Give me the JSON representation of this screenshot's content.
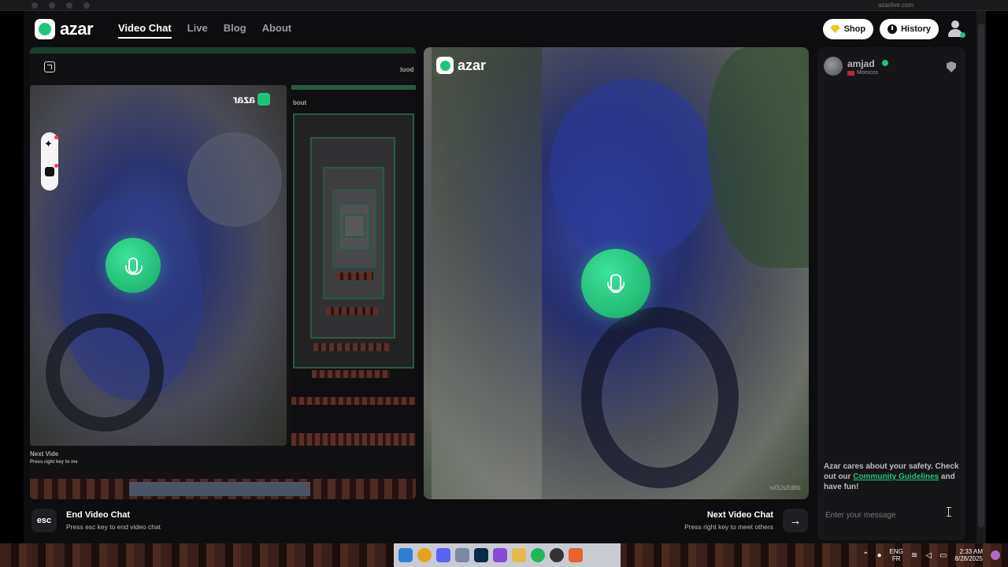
{
  "header": {
    "logo_text": "azar",
    "nav": [
      {
        "label": "Video Chat",
        "active": true
      },
      {
        "label": "Live",
        "active": false
      },
      {
        "label": "Blog",
        "active": false
      },
      {
        "label": "About",
        "active": false
      }
    ],
    "shop_label": "Shop",
    "history_label": "History"
  },
  "left_preview": {
    "mirror_logo": "azar",
    "mirror_about": "bout",
    "mirror_next_title": "Next Vide",
    "mirror_next_sub": "Press right key to me"
  },
  "main_video": {
    "logo_text": "azar",
    "watermark_id": "d8bSzU0vr"
  },
  "controls": {
    "esc_key": "esc",
    "end_title": "End Video Chat",
    "end_sub": "Press esc key to end video chat",
    "next_title": "Next Video Chat",
    "next_sub": "Press right key to meet others",
    "next_arrow": "→"
  },
  "chat": {
    "partner_name": "amjad",
    "partner_country": "Morocco",
    "safety_pre": "Azar cares about your safety. Check out our ",
    "safety_link": "Community Guidelines",
    "safety_post": " and have fun!",
    "message_placeholder": "Enter your message"
  },
  "system": {
    "browser_url": "azarlive.com",
    "lang_top": "ENG",
    "lang_bottom": "FR",
    "time": "2:33 AM",
    "date": "8/28/2025"
  },
  "colors": {
    "accent": "#1fc47a",
    "background": "#0d0d0f",
    "panel": "#161619"
  }
}
